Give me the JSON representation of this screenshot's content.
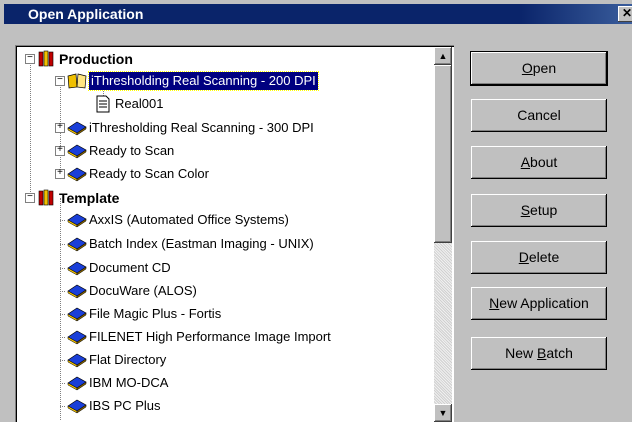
{
  "window": {
    "title": "Open Application",
    "close_glyph": "✕"
  },
  "tree": {
    "nodes": [
      {
        "id": "production",
        "label": "Production",
        "bold": true,
        "icon": "books-icon",
        "expander": "−"
      },
      {
        "id": "ithr200",
        "label": "iThresholding Real Scanning - 200 DPI",
        "selected": true,
        "icon": "open-book-icon",
        "expander": "−"
      },
      {
        "id": "real001",
        "label": "Real001",
        "icon": "document-icon"
      },
      {
        "id": "ithr300",
        "label": "iThresholding Real Scanning - 300 DPI",
        "icon": "book-icon",
        "expander": "+"
      },
      {
        "id": "rts",
        "label": "Ready to Scan",
        "icon": "book-icon",
        "expander": "+"
      },
      {
        "id": "rtsc",
        "label": "Ready to Scan Color",
        "icon": "book-icon",
        "expander": "+"
      },
      {
        "id": "template",
        "label": "Template",
        "bold": true,
        "icon": "books-icon",
        "expander": "−"
      },
      {
        "id": "axxis",
        "label": "AxxIS (Automated Office Systems)",
        "icon": "book-icon"
      },
      {
        "id": "batchidx",
        "label": "Batch Index (Eastman Imaging - UNIX)",
        "icon": "book-icon"
      },
      {
        "id": "doccd",
        "label": "Document CD",
        "icon": "book-icon"
      },
      {
        "id": "docuware",
        "label": "DocuWare (ALOS)",
        "icon": "book-icon"
      },
      {
        "id": "filemagic",
        "label": "File Magic Plus - Fortis",
        "icon": "book-icon"
      },
      {
        "id": "filenet",
        "label": "FILENET High Performance Image Import",
        "icon": "book-icon"
      },
      {
        "id": "flatdir",
        "label": "Flat Directory",
        "icon": "book-icon"
      },
      {
        "id": "ibmmo",
        "label": "IBM MO-DCA",
        "icon": "book-icon"
      },
      {
        "id": "ibspc",
        "label": "IBS PC Plus",
        "icon": "book-icon"
      }
    ]
  },
  "buttons": {
    "open": {
      "pre": "",
      "key": "O",
      "post": "pen"
    },
    "cancel": {
      "pre": "Cancel",
      "key": "",
      "post": ""
    },
    "about": {
      "pre": "",
      "key": "A",
      "post": "bout"
    },
    "setup": {
      "pre": "",
      "key": "S",
      "post": "etup"
    },
    "delete": {
      "pre": "",
      "key": "D",
      "post": "elete"
    },
    "new_application": {
      "pre": "",
      "key": "N",
      "post": "ew Application"
    },
    "new_batch": {
      "pre": "New ",
      "key": "B",
      "post": "atch"
    }
  },
  "colors": {
    "selection": "#000080",
    "title_bar": "#0a246a",
    "book_blue": "#1a3fd8",
    "book_yellow": "#f0c000",
    "books_red": "#c00000"
  }
}
